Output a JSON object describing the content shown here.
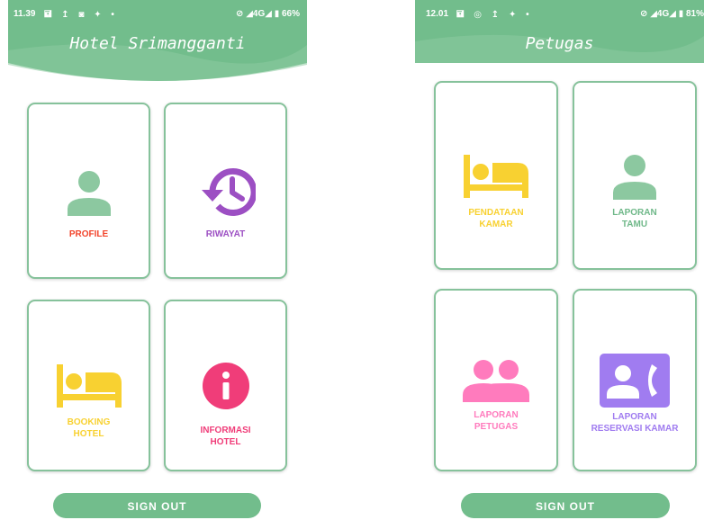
{
  "colors": {
    "header_green": "#72bd8c",
    "card_border": "#86c29b",
    "profile_red": "#f2452c",
    "riwayat_purple": "#9c4fc3",
    "booking_yellow": "#f8d131",
    "informasi_pink": "#f03d79",
    "tamu_green": "#8cc8a0",
    "petugas_pink": "#ff7bbd",
    "reservasi_purple": "#a07cf0"
  },
  "left_screen": {
    "status_bar": {
      "time": "11.39",
      "indicators": "🖬 ↥ ◙ ✦ •",
      "right": "⊘ ◢4G◢ ▮ 66%"
    },
    "title": "Hotel Srimangganti",
    "menu": [
      {
        "label": "PROFILE",
        "icon": "person-icon"
      },
      {
        "label": "RIWAYAT",
        "icon": "history-icon"
      },
      {
        "label_line1": "BOOKING",
        "label_line2": "HOTEL",
        "icon": "bed-icon"
      },
      {
        "label_line1": "INFORMASI",
        "label_line2": "HOTEL",
        "icon": "info-icon"
      }
    ],
    "signout_label": "SIGN OUT"
  },
  "right_screen": {
    "status_bar": {
      "time": "12.01",
      "indicators": "🖬 ◎ ↥ ✦ •",
      "right": "⊘ ◢4G◢ ▮ 81%"
    },
    "title": "Petugas",
    "menu": [
      {
        "label_line1": "PENDATAAN",
        "label_line2": "KAMAR",
        "icon": "bed-icon"
      },
      {
        "label_line1": "LAPORAN",
        "label_line2": "TAMU",
        "icon": "person-icon"
      },
      {
        "label_line1": "LAPORAN",
        "label_line2": "PETUGAS",
        "icon": "people-icon"
      },
      {
        "label_line1": "LAPORAN",
        "label_line2": "RESERVASI KAMAR",
        "icon": "contact-phone-icon"
      }
    ],
    "signout_label": "SIGN OUT"
  }
}
